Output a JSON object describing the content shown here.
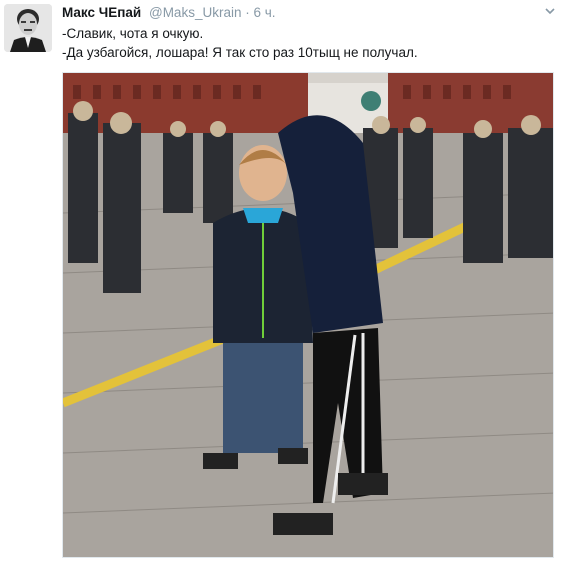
{
  "tweet": {
    "author_name": "Макс ЧЕпай",
    "author_handle": "@Maks_Ukrain",
    "separator": "·",
    "time": "6 ч.",
    "lines": [
      "-Славик, чота я очкую.",
      "-Да узбагойся, лошара! Я так сто раз 10тыщ не получал."
    ],
    "avatar_icon": "profile-photo-icon",
    "menu_icon": "chevron-down-icon",
    "photo_icon": "photo-icon"
  },
  "colors": {
    "name": "#14171a",
    "meta": "#8899a6",
    "text": "#14171a"
  }
}
